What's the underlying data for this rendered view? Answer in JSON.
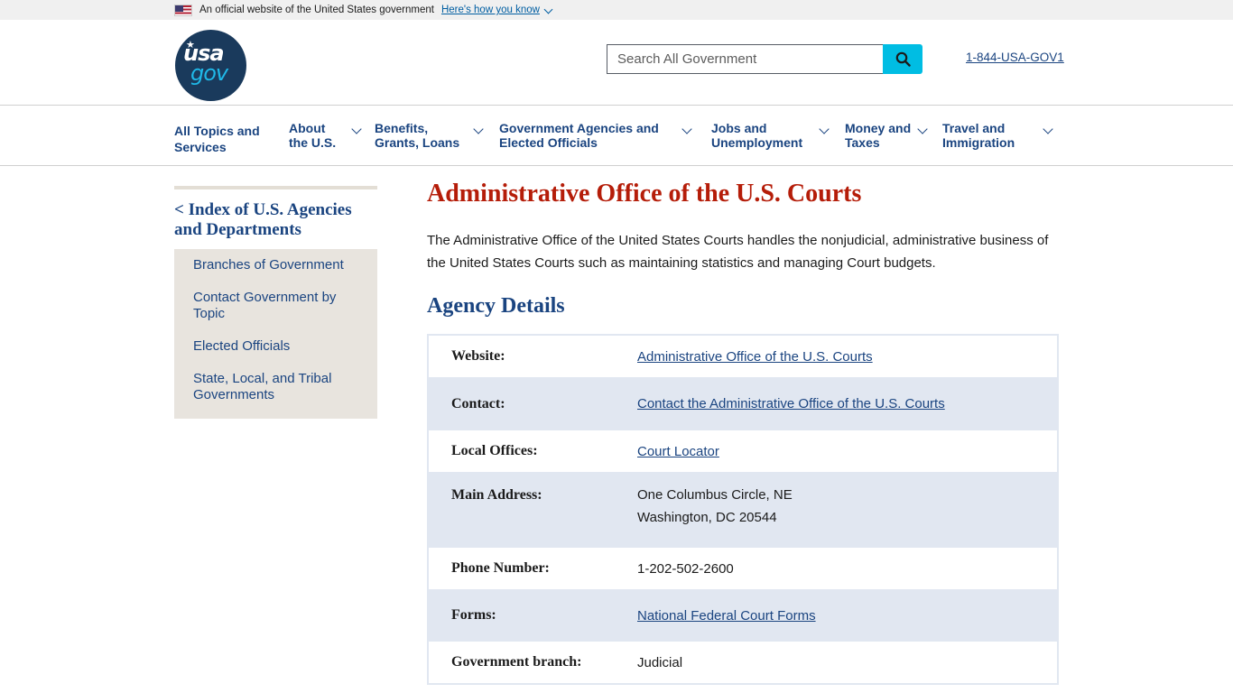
{
  "banner": {
    "text": "An official website of the United States government",
    "link": "Here's how you know"
  },
  "header": {
    "logo": {
      "line1": "usa",
      "line2": "gov"
    },
    "search": {
      "placeholder": "Search All Government"
    },
    "phone": "1-844-USA-GOV1"
  },
  "nav": {
    "items": [
      {
        "line1": "All Topics and",
        "line2": "Services"
      },
      {
        "line1": "About",
        "line2": "the U.S."
      },
      {
        "line1": "Benefits,",
        "line2": "Grants, Loans"
      },
      {
        "line1": "Government Agencies and",
        "line2": "Elected Officials"
      },
      {
        "line1": "Jobs and",
        "line2": "Unemployment"
      },
      {
        "line1": "Money and",
        "line2": "Taxes"
      },
      {
        "line1": "Travel and",
        "line2": "Immigration"
      }
    ]
  },
  "sidebar": {
    "title": "< Index of U.S. Agencies and Departments",
    "links": [
      "Branches of Government",
      "Contact Government by Topic",
      "Elected Officials",
      "State, Local, and Tribal Governments"
    ]
  },
  "main": {
    "title": "Administrative Office of the U.S. Courts",
    "intro": "The Administrative Office of the United States Courts handles the nonjudicial, administrative business of the United States Courts such as maintaining statistics and managing Court budgets.",
    "section_title": "Agency Details",
    "details": [
      {
        "key": "Website:",
        "value": "Administrative Office of the U.S. Courts",
        "link": true
      },
      {
        "key": "Contact:",
        "value": "Contact the Administrative Office of the U.S. Courts",
        "link": true
      },
      {
        "key": "Local Offices:",
        "value": "Court Locator",
        "link": true
      },
      {
        "key": "Main Address:",
        "value_line1": "One Columbus Circle, NE",
        "value_line2": "Washington, DC 20544",
        "link": false
      },
      {
        "key": "Phone Number:",
        "value": "1-202-502-2600",
        "link": false
      },
      {
        "key": "Forms:",
        "value": "National Federal Court Forms",
        "link": true
      },
      {
        "key": "Government branch:",
        "value": "Judicial",
        "link": false
      }
    ]
  },
  "colors": {
    "title_red": "#b51d09",
    "nav_blue": "#1a4480",
    "search_button": "#00bde3",
    "table_alt_row": "#e1e7f1",
    "sidebar_bg": "#e8e4de"
  },
  "icons": {
    "flag": "us-flag-icon",
    "banner_chevron": "chevron-down-icon",
    "search": "search-icon",
    "nav_chevron": "chevron-down-icon"
  }
}
